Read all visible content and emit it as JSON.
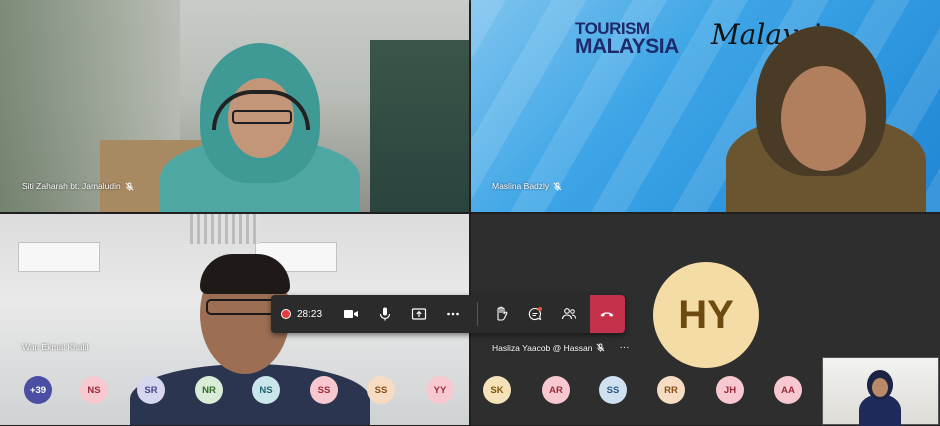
{
  "participants": {
    "tile1": {
      "name": "Siti Zaharah bt. Jamaludin"
    },
    "tile2": {
      "name": "Maslina Badzly",
      "logo_line1": "TOURISM",
      "logo_line2": "MALAYSIA",
      "script_text": "Malaysi"
    },
    "tile3": {
      "name": "Wan Ekmal Khalil"
    },
    "tile4": {
      "name": "Hasliza Yaacob @ Hassan",
      "initials": "HY",
      "more": "···"
    }
  },
  "controls": {
    "timer": "28:23"
  },
  "strip": [
    {
      "label": "+39",
      "bg": "#4a4fa3",
      "fg": "#ffffff"
    },
    {
      "label": "NS",
      "bg": "#f7c8cf",
      "fg": "#9b2a3a"
    },
    {
      "label": "SR",
      "bg": "#d6d6ef",
      "fg": "#454596"
    },
    {
      "label": "NR",
      "bg": "#d8ecd7",
      "fg": "#2f6b2c"
    },
    {
      "label": "NS",
      "bg": "#c9e6ea",
      "fg": "#1f6470"
    },
    {
      "label": "SS",
      "bg": "#f7c8cf",
      "fg": "#9b2a3a"
    },
    {
      "label": "SS",
      "bg": "#f6dcc3",
      "fg": "#8a4f18"
    },
    {
      "label": "YY",
      "bg": "#f7c8cf",
      "fg": "#9b2a3a"
    },
    {
      "label": "SK",
      "bg": "#f6e2b8",
      "fg": "#7f5611"
    },
    {
      "label": "AR",
      "bg": "#f7c8cf",
      "fg": "#9b2a3a"
    },
    {
      "label": "SS",
      "bg": "#cfe0f0",
      "fg": "#2a5a86"
    },
    {
      "label": "RR",
      "bg": "#f6dcc3",
      "fg": "#8a4f18"
    },
    {
      "label": "JH",
      "bg": "#f7c8cf",
      "fg": "#9b2a3a"
    },
    {
      "label": "AA",
      "bg": "#f7c8cf",
      "fg": "#9b2a3a"
    }
  ],
  "colors": {
    "hangup": "#c4314b",
    "recording": "#e23c3c",
    "avatar_bg": "#f4dca6"
  }
}
